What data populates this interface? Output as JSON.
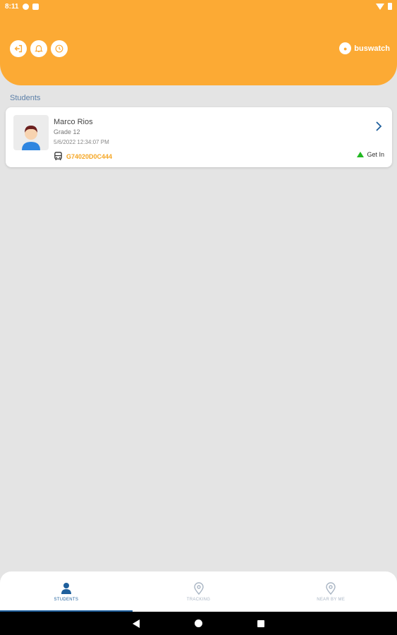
{
  "status_bar": {
    "time": "8:11"
  },
  "header": {
    "brand_name": "buswatch",
    "accent_color": "#fcaa34"
  },
  "section": {
    "title": "Students"
  },
  "students": [
    {
      "name": "Marco Rios",
      "grade": "Grade 12",
      "timestamp": "5/6/2022 12:34:07 PM",
      "bus_id": "G74020D0C444",
      "status": "Get In",
      "status_color": "#22b822"
    }
  ],
  "bottom_nav": {
    "items": [
      {
        "label": "STUDENTS",
        "icon": "person-icon",
        "active": true
      },
      {
        "label": "TRACKING",
        "icon": "location-pin-icon",
        "active": false
      },
      {
        "label": "NEAR BY ME",
        "icon": "location-pin-icon",
        "active": false
      }
    ]
  }
}
